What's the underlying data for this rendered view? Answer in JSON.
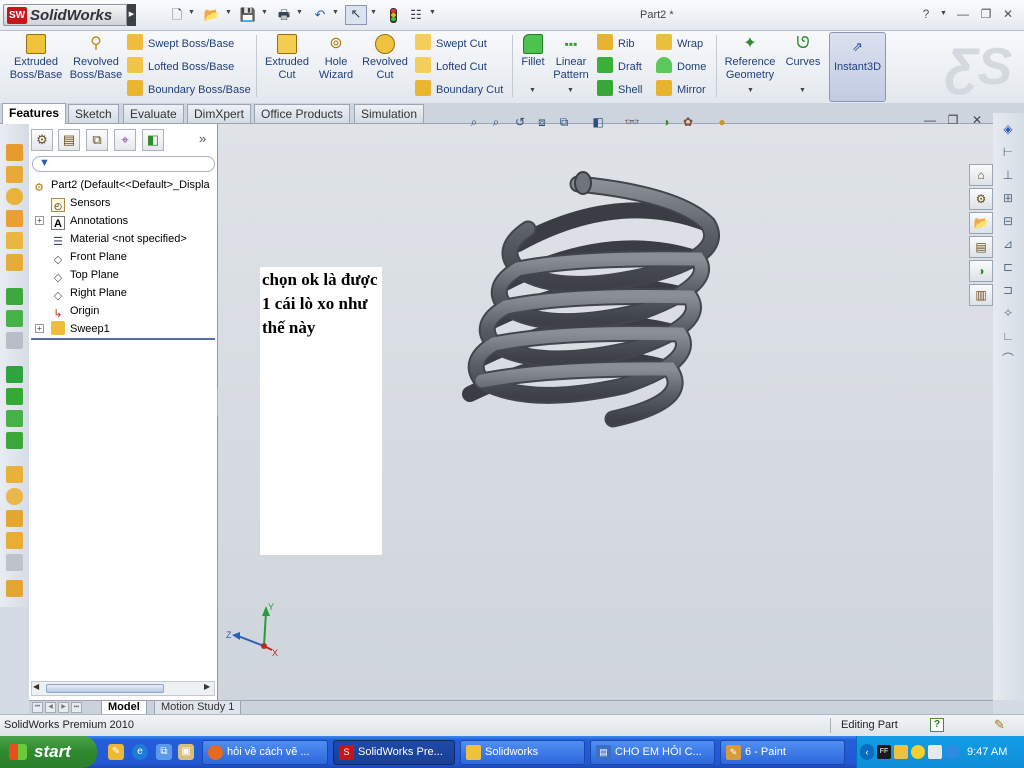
{
  "titlebar": {
    "app_name": "SolidWorks",
    "app_badge": "SW",
    "document_title": "Part2 *",
    "help_label": "?"
  },
  "command_manager": {
    "extruded_boss": "Extruded Boss/Base",
    "revolved_boss": "Revolved Boss/Base",
    "swept_boss": "Swept Boss/Base",
    "lofted_boss": "Lofted Boss/Base",
    "boundary_boss": "Boundary Boss/Base",
    "extruded_cut": "Extruded Cut",
    "hole_wizard": "Hole Wizard",
    "revolved_cut": "Revolved Cut",
    "swept_cut": "Swept Cut",
    "lofted_cut": "Lofted Cut",
    "boundary_cut": "Boundary Cut",
    "fillet": "Fillet",
    "linear_pattern": "Linear Pattern",
    "rib": "Rib",
    "draft": "Draft",
    "shell": "Shell",
    "wrap": "Wrap",
    "dome": "Dome",
    "mirror": "Mirror",
    "reference_geometry": "Reference Geometry",
    "curves": "Curves",
    "instant3d": "Instant3D"
  },
  "tabs": [
    "Features",
    "Sketch",
    "Evaluate",
    "DimXpert",
    "Office Products",
    "Simulation"
  ],
  "feature_tree": {
    "root": "Part2  (Default<<Default>_Displa",
    "items": [
      "Sensors",
      "Annotations",
      "Material <not specified>",
      "Front Plane",
      "Top Plane",
      "Right Plane",
      "Origin",
      "Sweep1"
    ]
  },
  "annotation_note": {
    "text": "chọn ok là được 1 cái lò xo như thế này"
  },
  "triad": {
    "x_label": "X",
    "y_label": "Y",
    "z_label": "Z"
  },
  "bottom_tabs": [
    "Model",
    "Motion Study 1"
  ],
  "status_bar": {
    "product": "SolidWorks Premium 2010",
    "mode": "Editing Part",
    "help": "?"
  },
  "taskbar": {
    "start_label": "start",
    "buttons": [
      "hỏi về cách vẽ ...",
      "SolidWorks Pre...",
      "Solidworks",
      "CHO EM HỎI C...",
      "6 - Paint"
    ],
    "time": "9:47 AM",
    "tray_ff": "FF"
  },
  "colors": {
    "sw_red": "#c8151b",
    "viewport_bg": "#d6dbe1",
    "spring_grey": "#5a5f66",
    "taskbar_blue": "#245edb",
    "start_green": "#3a963a"
  }
}
